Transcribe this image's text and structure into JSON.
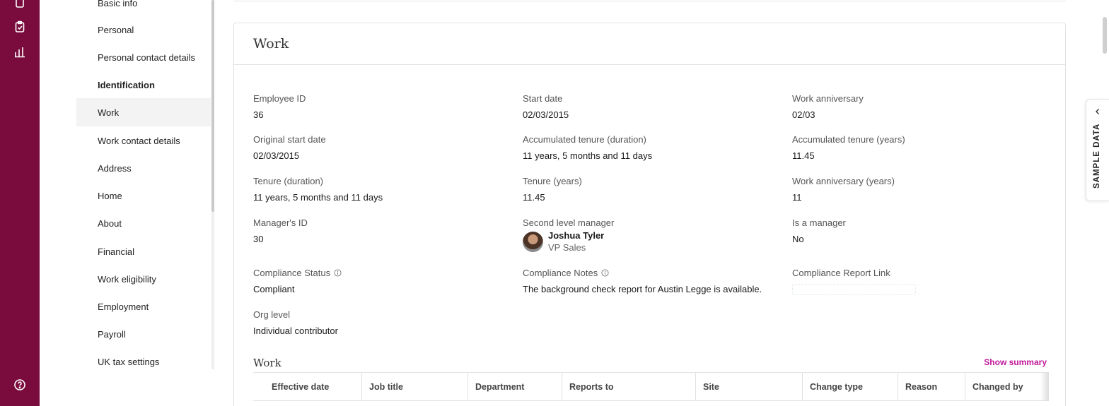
{
  "rail": {
    "icons": [
      "document-icon",
      "clipboard-check-icon",
      "bar-chart-icon",
      "help-circle-icon"
    ]
  },
  "nav": {
    "items": [
      {
        "label": "Basic info"
      },
      {
        "label": "Personal"
      },
      {
        "label": "Personal contact details"
      },
      {
        "label": "Identification"
      },
      {
        "label": "Work"
      },
      {
        "label": "Work contact details"
      },
      {
        "label": "Address"
      },
      {
        "label": "Home"
      },
      {
        "label": "About"
      },
      {
        "label": "Financial"
      },
      {
        "label": "Work eligibility"
      },
      {
        "label": "Employment"
      },
      {
        "label": "Payroll"
      },
      {
        "label": "UK tax settings"
      }
    ],
    "active": "Work"
  },
  "card": {
    "title": "Work",
    "fields": {
      "employee_id": {
        "label": "Employee ID",
        "value": "36"
      },
      "start_date": {
        "label": "Start date",
        "value": "02/03/2015"
      },
      "work_anniversary": {
        "label": "Work anniversary",
        "value": "02/03"
      },
      "original_start_date": {
        "label": "Original start date",
        "value": "02/03/2015"
      },
      "acc_tenure_duration": {
        "label": "Accumulated tenure (duration)",
        "value": "11 years, 5 months and 11 days"
      },
      "acc_tenure_years": {
        "label": "Accumulated tenure (years)",
        "value": "11.45"
      },
      "tenure_duration": {
        "label": "Tenure (duration)",
        "value": "11 years, 5 months and 11 days"
      },
      "tenure_years": {
        "label": "Tenure (years)",
        "value": "11.45"
      },
      "work_anniversary_years": {
        "label": "Work anniversary (years)",
        "value": "11"
      },
      "manager_id": {
        "label": "Manager's ID",
        "value": "30"
      },
      "second_level_manager": {
        "label": "Second level manager",
        "name": "Joshua Tyler",
        "role": "VP Sales"
      },
      "is_manager": {
        "label": "Is a manager",
        "value": "No"
      },
      "compliance_status": {
        "label": "Compliance Status",
        "value": "Compliant"
      },
      "compliance_notes": {
        "label": "Compliance Notes",
        "value": "The background check report for Austin Legge is available."
      },
      "compliance_report_link": {
        "label": "Compliance Report Link"
      },
      "org_level": {
        "label": "Org level",
        "value": "Individual contributor"
      }
    },
    "history": {
      "title": "Work",
      "show_summary": "Show summary",
      "columns": [
        "Effective date",
        "Job title",
        "Department",
        "Reports to",
        "Site",
        "Change type",
        "Reason",
        "Changed by"
      ]
    }
  },
  "side_tab": {
    "label": "SAMPLE DATA"
  }
}
